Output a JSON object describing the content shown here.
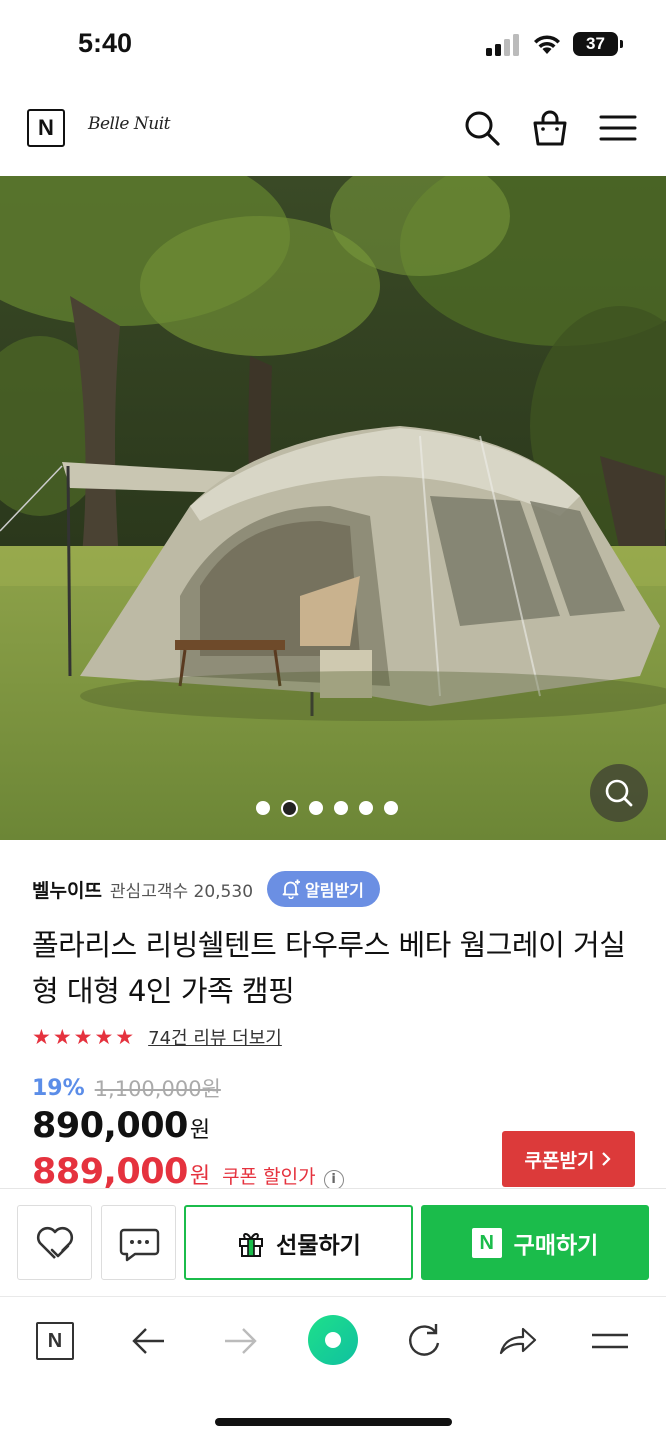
{
  "status_bar": {
    "time": "5:40",
    "battery": "37"
  },
  "header": {
    "platform_logo": "N",
    "brand_logo_text": "Belle Nuit",
    "icons": [
      "search-icon",
      "shopping-bag-icon",
      "menu-icon"
    ]
  },
  "gallery": {
    "slide_count": 6,
    "active_slide": 2,
    "zoom_icon": "magnifier-icon"
  },
  "store": {
    "name": "벨누이뜨",
    "followers_label": "관심고객수 20,530",
    "alarm_button": "알림받기"
  },
  "product": {
    "title": "폴라리스 리빙쉘텐트 타우루스 베타 웜그레이 거실형 대형 4인 가족 캠핑",
    "rating_stars": 5,
    "review_link": "74건 리뷰 더보기",
    "discount_rate": "19%",
    "original_price": "1,100,000원",
    "price": "890,000",
    "price_unit": "원",
    "coupon_price": "889,000",
    "coupon_price_unit": "원",
    "coupon_label": "쿠폰 할인가",
    "coupon_button": "쿠폰받기"
  },
  "action_bar": {
    "gift_button": "선물하기",
    "buy_button": "구매하기",
    "buy_badge": "N"
  },
  "browser_bar": {
    "home_badge": "N",
    "icons": [
      "naver-home-icon",
      "back-arrow-icon",
      "forward-arrow-icon",
      "green-dot-icon",
      "reload-icon",
      "share-icon",
      "menu-icon"
    ]
  },
  "colors": {
    "naver_green": "#1bbc4b",
    "sale_red": "#e5323e",
    "discount_blue": "#5b8de8",
    "alarm_blue": "#6b8fe3"
  }
}
